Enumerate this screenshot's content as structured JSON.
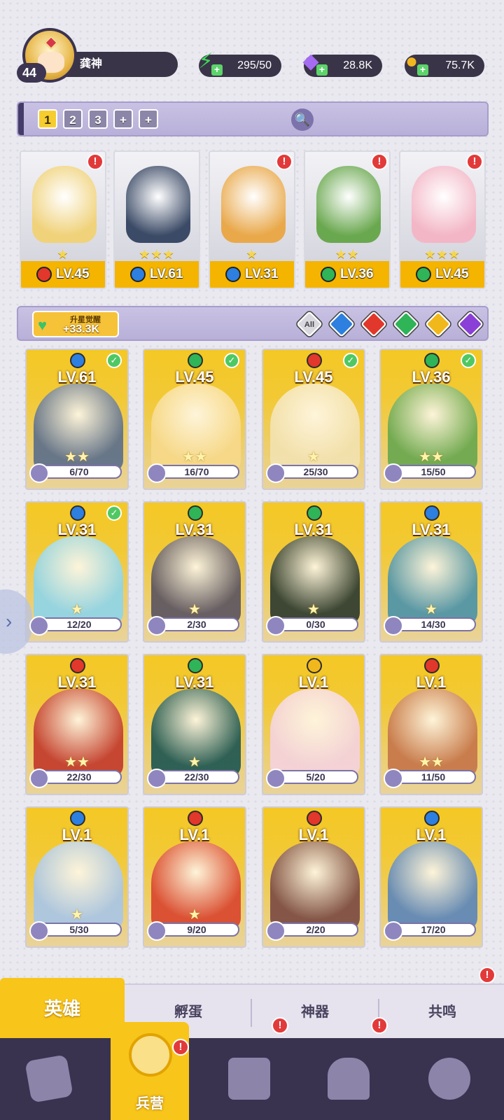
{
  "player": {
    "level": "44",
    "name": "龚神"
  },
  "resources": [
    {
      "name": "energy",
      "icon": "lightning-icon",
      "value": "295/50",
      "color": "#3fd95a"
    },
    {
      "name": "gems",
      "icon": "diamond-icon",
      "value": "28.8K",
      "color": "#a56bf2"
    },
    {
      "name": "coins",
      "icon": "coin-icon",
      "value": "75.7K",
      "color": "#f2b620"
    }
  ],
  "team_slots": [
    "1",
    "2",
    "3",
    "+",
    "+"
  ],
  "team": [
    {
      "level": "LV.45",
      "element": "fire",
      "stars": "★",
      "alert": true
    },
    {
      "level": "LV.61",
      "element": "water",
      "stars": "★★★",
      "alert": false
    },
    {
      "level": "LV.31",
      "element": "water",
      "stars": "★",
      "alert": true
    },
    {
      "level": "LV.36",
      "element": "wind",
      "stars": "★★",
      "alert": true
    },
    {
      "level": "LV.45",
      "element": "wind",
      "stars": "★★★",
      "alert": true
    }
  ],
  "awaken": {
    "title": "升星觉醒",
    "value": "+33.3K"
  },
  "filters": [
    "All",
    "water",
    "fire",
    "wind",
    "light",
    "dark"
  ],
  "element_colors": {
    "fire": "#e2372b",
    "water": "#2d7fe0",
    "wind": "#2fb458",
    "light": "#f1b81c",
    "dark": "#8a3fd6"
  },
  "heroes": [
    {
      "level": "LV.61",
      "element": "water",
      "progress": "6/70",
      "stars": "★★",
      "checked": true
    },
    {
      "level": "LV.45",
      "element": "wind",
      "progress": "16/70",
      "stars": "★★",
      "checked": true
    },
    {
      "level": "LV.45",
      "element": "fire",
      "progress": "25/30",
      "stars": "★",
      "checked": true
    },
    {
      "level": "LV.36",
      "element": "wind",
      "progress": "15/50",
      "stars": "★★",
      "checked": true
    },
    {
      "level": "LV.31",
      "element": "water",
      "progress": "12/20",
      "stars": "★",
      "checked": true
    },
    {
      "level": "LV.31",
      "element": "wind",
      "progress": "2/30",
      "stars": "★",
      "checked": false
    },
    {
      "level": "LV.31",
      "element": "wind",
      "progress": "0/30",
      "stars": "★",
      "checked": false
    },
    {
      "level": "LV.31",
      "element": "water",
      "progress": "14/30",
      "stars": "★",
      "checked": false
    },
    {
      "level": "LV.31",
      "element": "fire",
      "progress": "22/30",
      "stars": "★★",
      "checked": false
    },
    {
      "level": "LV.31",
      "element": "wind",
      "progress": "22/30",
      "stars": "★",
      "checked": false
    },
    {
      "level": "LV.1",
      "element": "light",
      "progress": "5/20",
      "stars": "",
      "checked": false
    },
    {
      "level": "LV.1",
      "element": "fire",
      "progress": "11/50",
      "stars": "★★",
      "checked": false
    },
    {
      "level": "LV.1",
      "element": "water",
      "progress": "5/30",
      "stars": "★",
      "checked": false
    },
    {
      "level": "LV.1",
      "element": "fire",
      "progress": "9/20",
      "stars": "★",
      "checked": false
    },
    {
      "level": "LV.1",
      "element": "fire",
      "progress": "2/20",
      "stars": "",
      "checked": false
    },
    {
      "level": "LV.1",
      "element": "water",
      "progress": "17/20",
      "stars": "",
      "checked": false
    }
  ],
  "tabs": [
    "英雄",
    "孵蛋",
    "神器",
    "共鸣"
  ],
  "nav": {
    "active_label": "兵营"
  }
}
